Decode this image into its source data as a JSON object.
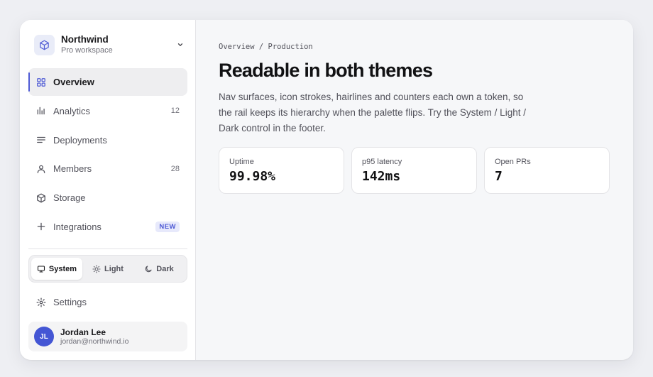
{
  "workspace": {
    "name": "Northwind",
    "plan": "Pro workspace"
  },
  "nav": {
    "items": [
      {
        "label": "Overview",
        "icon": "grid-icon",
        "active": true
      },
      {
        "label": "Analytics",
        "icon": "bar-chart-icon",
        "count": "12"
      },
      {
        "label": "Deployments",
        "icon": "list-icon"
      },
      {
        "label": "Members",
        "icon": "user-icon",
        "count": "28"
      },
      {
        "label": "Storage",
        "icon": "cube-icon"
      },
      {
        "label": "Integrations",
        "icon": "plus-icon",
        "badge": "NEW"
      }
    ]
  },
  "theme_switcher": {
    "options": [
      "System",
      "Light",
      "Dark"
    ],
    "selected": "System"
  },
  "settings": {
    "label": "Settings"
  },
  "user": {
    "initials": "JL",
    "name": "Jordan Lee",
    "email": "jordan@northwind.io"
  },
  "main": {
    "breadcrumb": "Overview / Production",
    "title": "Readable in both themes",
    "description": "Nav surfaces, icon strokes, hairlines and counters each own a token, so the rail keeps its hierarchy when the palette flips. Try the System / Light / Dark control in the footer.",
    "stats": [
      {
        "label": "Uptime",
        "value": "99.98%"
      },
      {
        "label": "p95 latency",
        "value": "142ms"
      },
      {
        "label": "Open PRs",
        "value": "7"
      }
    ]
  },
  "colors": {
    "accent": "#4f5bd5",
    "avatar": "#4456d4",
    "page_bg": "#eeeff3",
    "main_bg": "#f6f7f9"
  }
}
